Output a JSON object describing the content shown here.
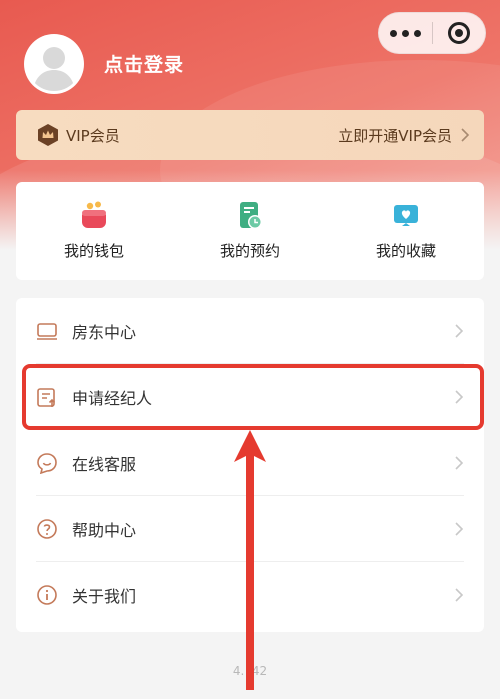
{
  "header": {
    "login_text": "点击登录"
  },
  "vip": {
    "label": "VIP会员",
    "cta": "立即开通VIP会员",
    "color": "#f6d9bd"
  },
  "quick_actions": [
    {
      "label": "我的钱包",
      "icon": "wallet-icon"
    },
    {
      "label": "我的预约",
      "icon": "appointment-icon"
    },
    {
      "label": "我的收藏",
      "icon": "favorite-icon"
    }
  ],
  "menu": [
    {
      "label": "房东中心",
      "icon": "landlord-icon"
    },
    {
      "label": "申请经纪人",
      "icon": "apply-agent-icon"
    },
    {
      "label": "在线客服",
      "icon": "customer-service-icon"
    },
    {
      "label": "帮助中心",
      "icon": "help-icon"
    },
    {
      "label": "关于我们",
      "icon": "info-icon"
    }
  ],
  "version": "4.  .42",
  "accent": "#e85a50",
  "highlight_color": "#e53a2f"
}
